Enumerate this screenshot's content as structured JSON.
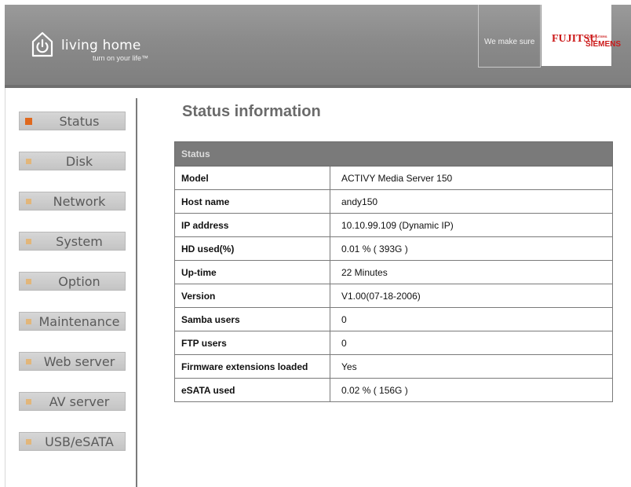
{
  "header": {
    "brand_name": "living home",
    "brand_tagline": "turn on your life™",
    "slogan": "We make sure",
    "vendor_brand": "FUJITSU",
    "vendor_computers": "COMPUTERS",
    "vendor_siemens": "SIEMENS",
    "logo_icon": "power-house-icon"
  },
  "nav": {
    "items": [
      {
        "label": "Status",
        "active": true
      },
      {
        "label": "Disk",
        "active": false
      },
      {
        "label": "Network",
        "active": false
      },
      {
        "label": "System",
        "active": false
      },
      {
        "label": "Option",
        "active": false
      },
      {
        "label": "Maintenance",
        "active": false
      },
      {
        "label": "Web server",
        "active": false
      },
      {
        "label": "AV server",
        "active": false
      },
      {
        "label": "USB/eSATA",
        "active": false
      }
    ]
  },
  "main": {
    "title": "Status information",
    "table": {
      "header": "Status",
      "rows": [
        {
          "label": "Model",
          "value": "ACTIVY Media Server 150"
        },
        {
          "label": "Host name",
          "value": "andy150"
        },
        {
          "label": "IP address",
          "value": "10.10.99.109 (Dynamic IP)"
        },
        {
          "label": "HD used(%)",
          "value": "0.01 % ( 393G )"
        },
        {
          "label": "Up-time",
          "value": "22 Minutes"
        },
        {
          "label": "Version",
          "value": "V1.00(07-18-2006)"
        },
        {
          "label": "Samba users",
          "value": "0"
        },
        {
          "label": "FTP users",
          "value": "0"
        },
        {
          "label": "Firmware extensions loaded",
          "value": "Yes"
        },
        {
          "label": "eSATA used",
          "value": "0.02 % ( 156G )"
        }
      ]
    }
  },
  "colors": {
    "header_gray": "#8a8a8a",
    "active_bullet": "#e0681d",
    "inactive_bullet": "#e2b67a",
    "table_header": "#7a7a7a",
    "vendor_red": "#cc1a1a"
  }
}
